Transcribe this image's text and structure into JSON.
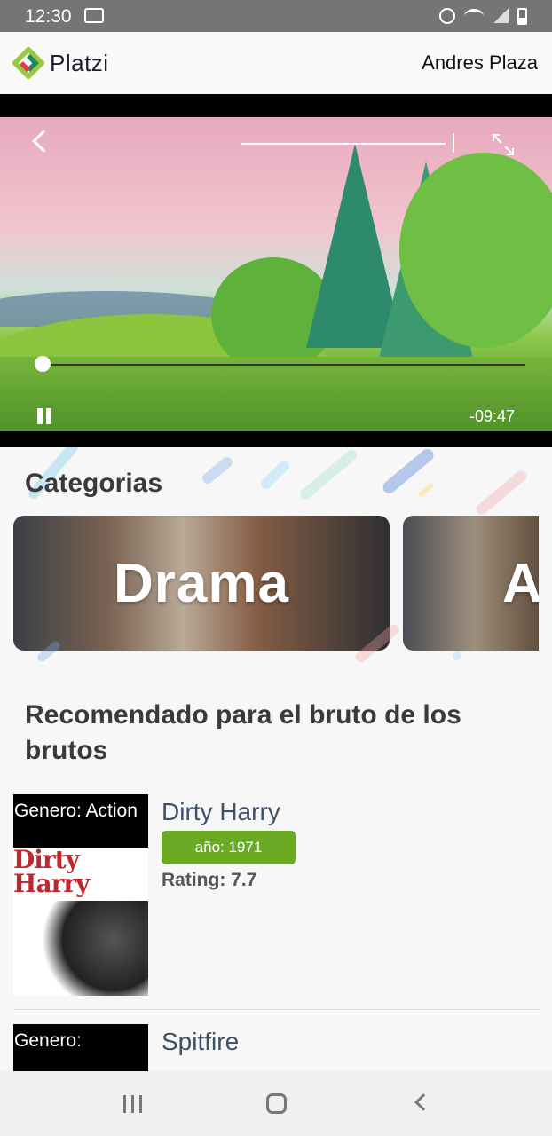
{
  "status_bar": {
    "time": "12:30"
  },
  "header": {
    "brand": "Platzi",
    "user_name": "Andres Plaza"
  },
  "player": {
    "time_remaining": "-09:47",
    "state": "playing",
    "progress": 0.0
  },
  "categories": {
    "title": "Categorias",
    "items": [
      {
        "label": "Drama"
      },
      {
        "label": "A"
      }
    ]
  },
  "recommended": {
    "title": "Recomendado para el bruto de los brutos",
    "items": [
      {
        "genre": "Genero: Action",
        "poster_title": "Dirty Harry",
        "title": "Dirty Harry",
        "year": "año: 1971",
        "rating": "Rating: 7.7"
      },
      {
        "genre": "Genero:",
        "title": "Spitfire"
      }
    ]
  },
  "colors": {
    "accent_green": "#6aaa24",
    "title_blue": "#3e5068",
    "status_bar": "#757575"
  }
}
